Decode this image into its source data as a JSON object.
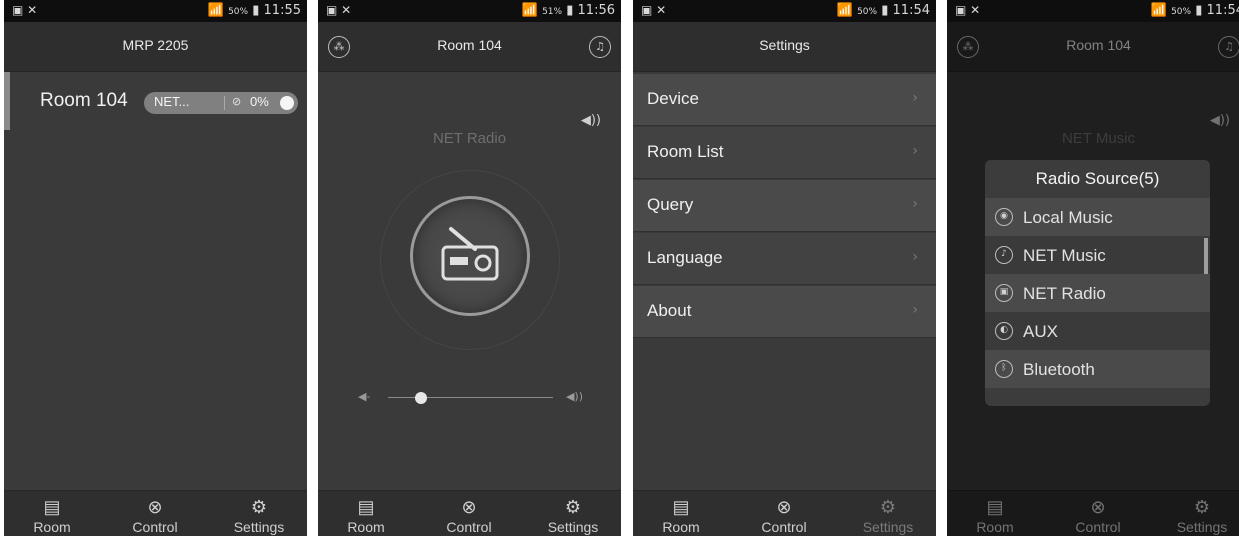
{
  "status": {
    "screen1": {
      "battery": "50%",
      "time": "11:55"
    },
    "screen2": {
      "battery": "51%",
      "time": "11:56"
    },
    "screen3": {
      "battery": "50%",
      "time": "11:54"
    },
    "screen4": {
      "battery": "50%",
      "time": "11:54"
    }
  },
  "screen1": {
    "title": "MRP 2205",
    "rooms": [
      {
        "name": "Room 104",
        "source": "NET...",
        "volume": "0%"
      }
    ]
  },
  "screen2": {
    "title": "Room 104",
    "source_label": "NET Radio",
    "volume_level": 0.2
  },
  "screen3": {
    "title": "Settings",
    "menu": [
      {
        "label": "Device"
      },
      {
        "label": "Room List"
      },
      {
        "label": "Query"
      },
      {
        "label": "Language"
      },
      {
        "label": "About"
      }
    ]
  },
  "screen4": {
    "title": "Room 104",
    "source_label": "NET Music",
    "modal": {
      "title": "Radio Source(5)",
      "options": [
        {
          "label": "Local Music",
          "icon": "music-disc-icon"
        },
        {
          "label": "NET Music",
          "icon": "net-music-icon"
        },
        {
          "label": "NET Radio",
          "icon": "radio-icon"
        },
        {
          "label": "AUX",
          "icon": "aux-icon"
        },
        {
          "label": "Bluetooth",
          "icon": "bluetooth-icon"
        }
      ]
    }
  },
  "tabs": [
    {
      "label": "Room",
      "icon": "room-icon"
    },
    {
      "label": "Control",
      "icon": "control-icon"
    },
    {
      "label": "Settings",
      "icon": "settings-icon"
    }
  ]
}
